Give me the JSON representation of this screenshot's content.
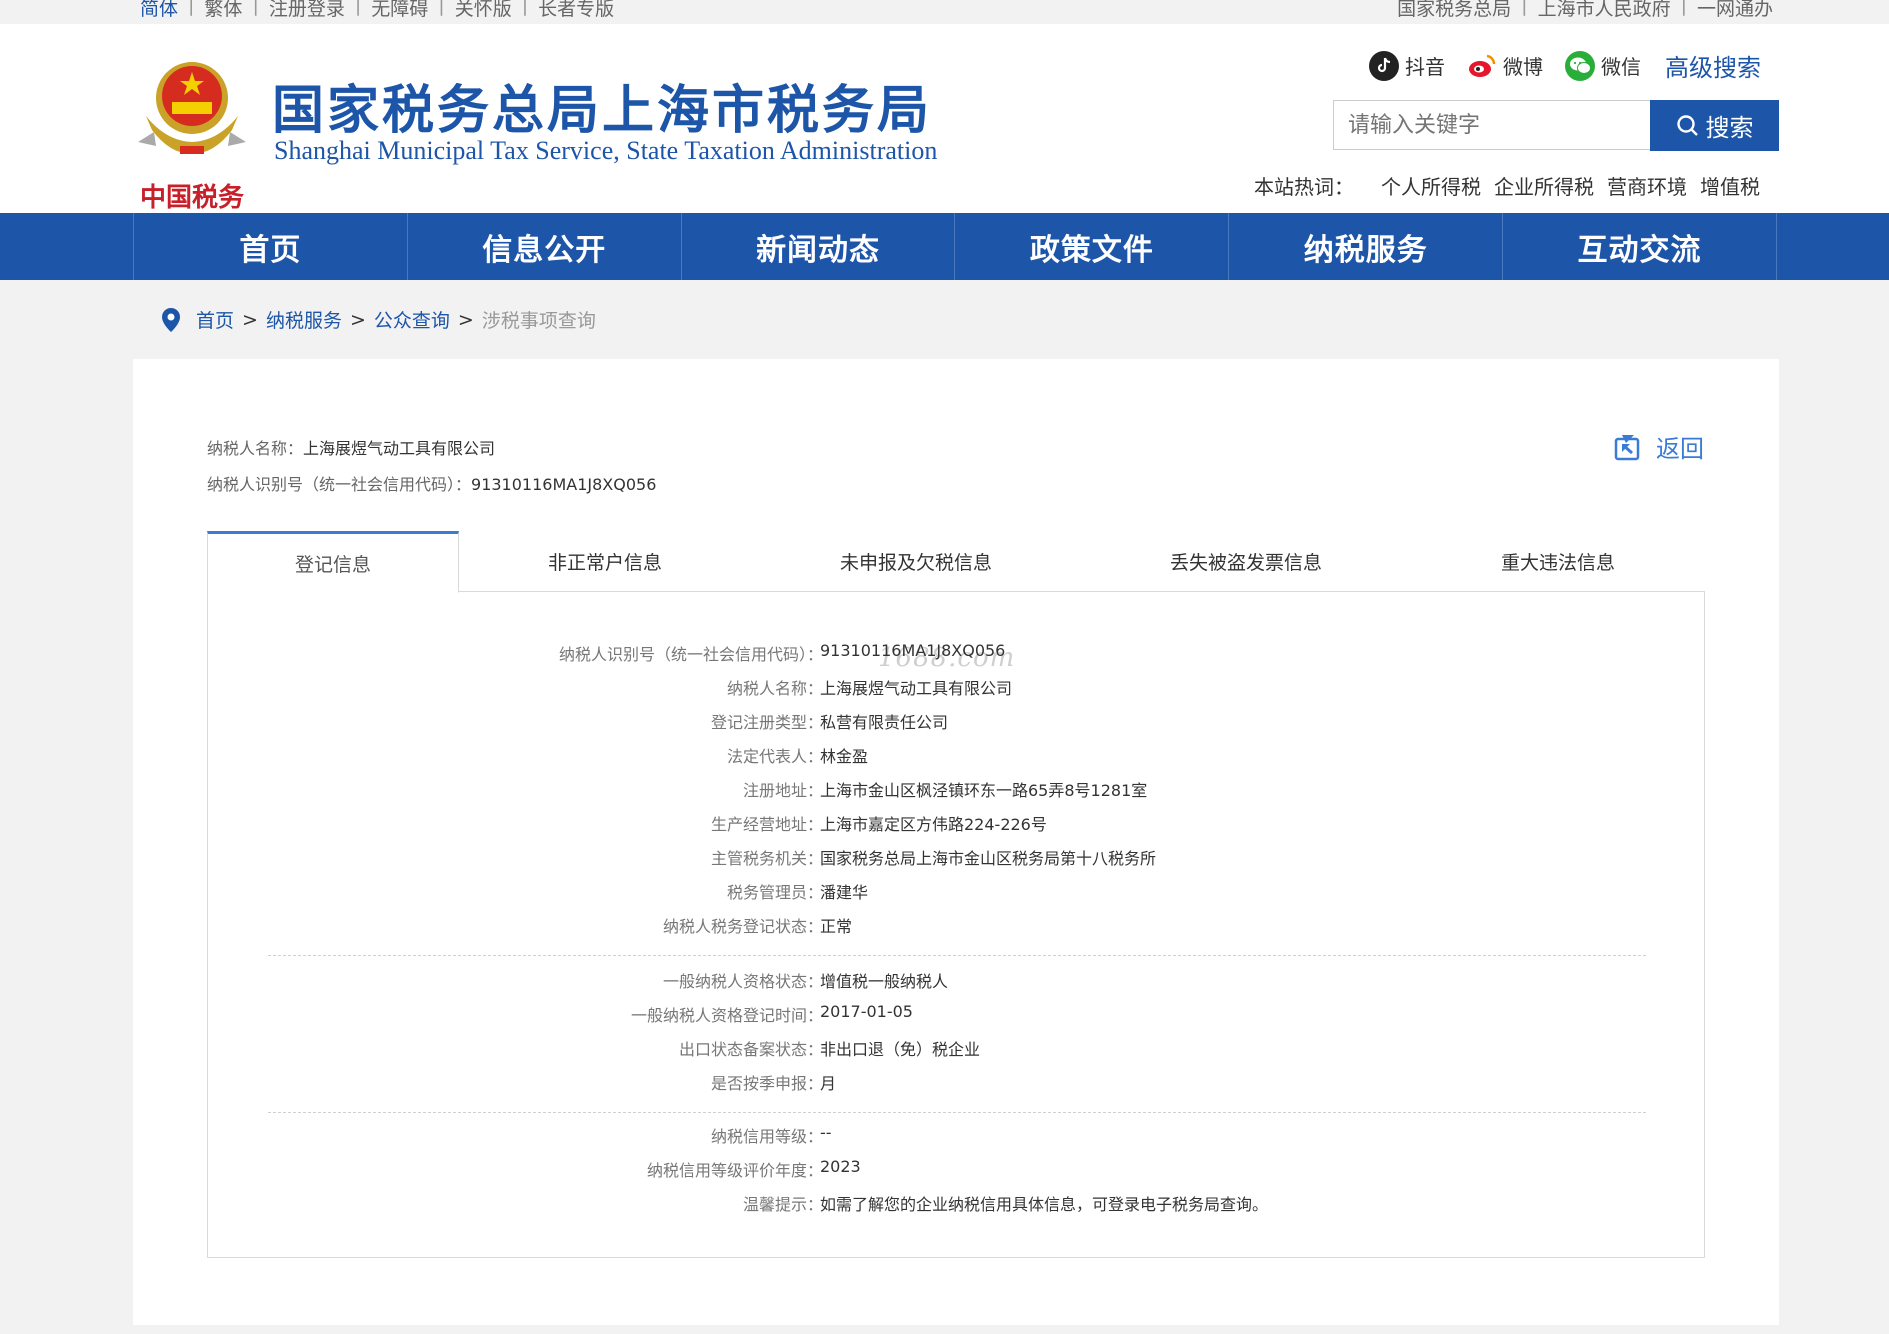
{
  "topbar": {
    "left": [
      "简体",
      "繁体",
      "注册登录",
      "无障碍",
      "关怀版",
      "长者专版"
    ],
    "right": [
      "国家税务总局",
      "上海市人民政府",
      "一网通办"
    ]
  },
  "header": {
    "title": "国家税务总局上海市税务局",
    "subtitle": "Shanghai Municipal Tax Service, State Taxation Administration",
    "social": {
      "douyin": "抖音",
      "weibo": "微博",
      "wechat": "微信",
      "advanced_search": "高级搜索"
    },
    "search": {
      "placeholder": "请输入关键字",
      "button": "搜索"
    },
    "hotwords": {
      "label": "本站热词：",
      "items": [
        "个人所得税",
        "企业所得税",
        "营商环境",
        "增值税"
      ]
    }
  },
  "nav": [
    "首页",
    "信息公开",
    "新闻动态",
    "政策文件",
    "纳税服务",
    "互动交流"
  ],
  "breadcrumb": {
    "items": [
      "首页",
      "纳税服务",
      "公众查询"
    ],
    "current": "涉税事项查询",
    "sep": ">"
  },
  "taxpayer": {
    "name_label": "纳税人名称：",
    "name": "上海展煜气动工具有限公司",
    "id_label": "纳税人识别号（统一社会信用代码）：",
    "id": "91310116MA1J8XQ056",
    "back": "返回"
  },
  "tabs": [
    "登记信息",
    "非正常户信息",
    "未申报及欠税信息",
    "丢失被盗发票信息",
    "重大违法信息"
  ],
  "watermark": "1688.com",
  "details": {
    "group1": [
      {
        "k": "纳税人识别号（统一社会信用代码）：",
        "v": "91310116MA1J8XQ056"
      },
      {
        "k": "纳税人名称：",
        "v": "上海展煜气动工具有限公司"
      },
      {
        "k": "登记注册类型：",
        "v": "私营有限责任公司"
      },
      {
        "k": "法定代表人：",
        "v": "林金盈"
      },
      {
        "k": "注册地址：",
        "v": "上海市金山区枫泾镇环东一路65弄8号1281室"
      },
      {
        "k": "生产经营地址：",
        "v": "上海市嘉定区方伟路224-226号"
      },
      {
        "k": "主管税务机关：",
        "v": "国家税务总局上海市金山区税务局第十八税务所"
      },
      {
        "k": "税务管理员：",
        "v": "潘建华"
      },
      {
        "k": "纳税人税务登记状态：",
        "v": "正常"
      }
    ],
    "group2": [
      {
        "k": "一般纳税人资格状态：",
        "v": "增值税一般纳税人"
      },
      {
        "k": "一般纳税人资格登记时间：",
        "v": "2017-01-05"
      },
      {
        "k": "出口状态备案状态：",
        "v": "非出口退（免）税企业"
      },
      {
        "k": "是否按季申报：",
        "v": "月"
      }
    ],
    "group3": [
      {
        "k": "纳税信用等级：",
        "v": "--"
      },
      {
        "k": "纳税信用等级评价年度：",
        "v": "2023"
      },
      {
        "k": "温馨提示：",
        "v": "如需了解您的企业纳税信用具体信息，可登录电子税务局查询。"
      }
    ]
  },
  "colors": {
    "brand": "#1d55a8",
    "accent": "#3a7bd5"
  }
}
